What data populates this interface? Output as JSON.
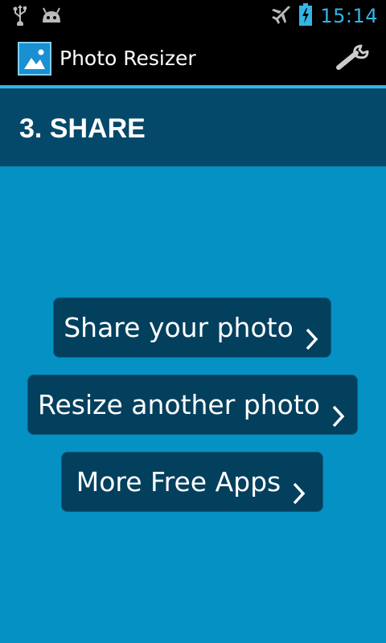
{
  "status_bar": {
    "time": "15:14",
    "icons": [
      "usb-icon",
      "android-icon",
      "airplane-mode-icon",
      "battery-charging-icon"
    ]
  },
  "action_bar": {
    "app_title": "Photo Resizer",
    "app_icon": "image-icon",
    "settings_icon": "wrench-icon"
  },
  "section": {
    "title": "3. SHARE"
  },
  "buttons": {
    "share_label": "Share your photo",
    "resize_label": "Resize another photo",
    "apps_label": "More Free Apps"
  },
  "colors": {
    "background": "#0591c4",
    "header": "#04496a",
    "button": "#03405e",
    "accent": "#33b5e5"
  }
}
